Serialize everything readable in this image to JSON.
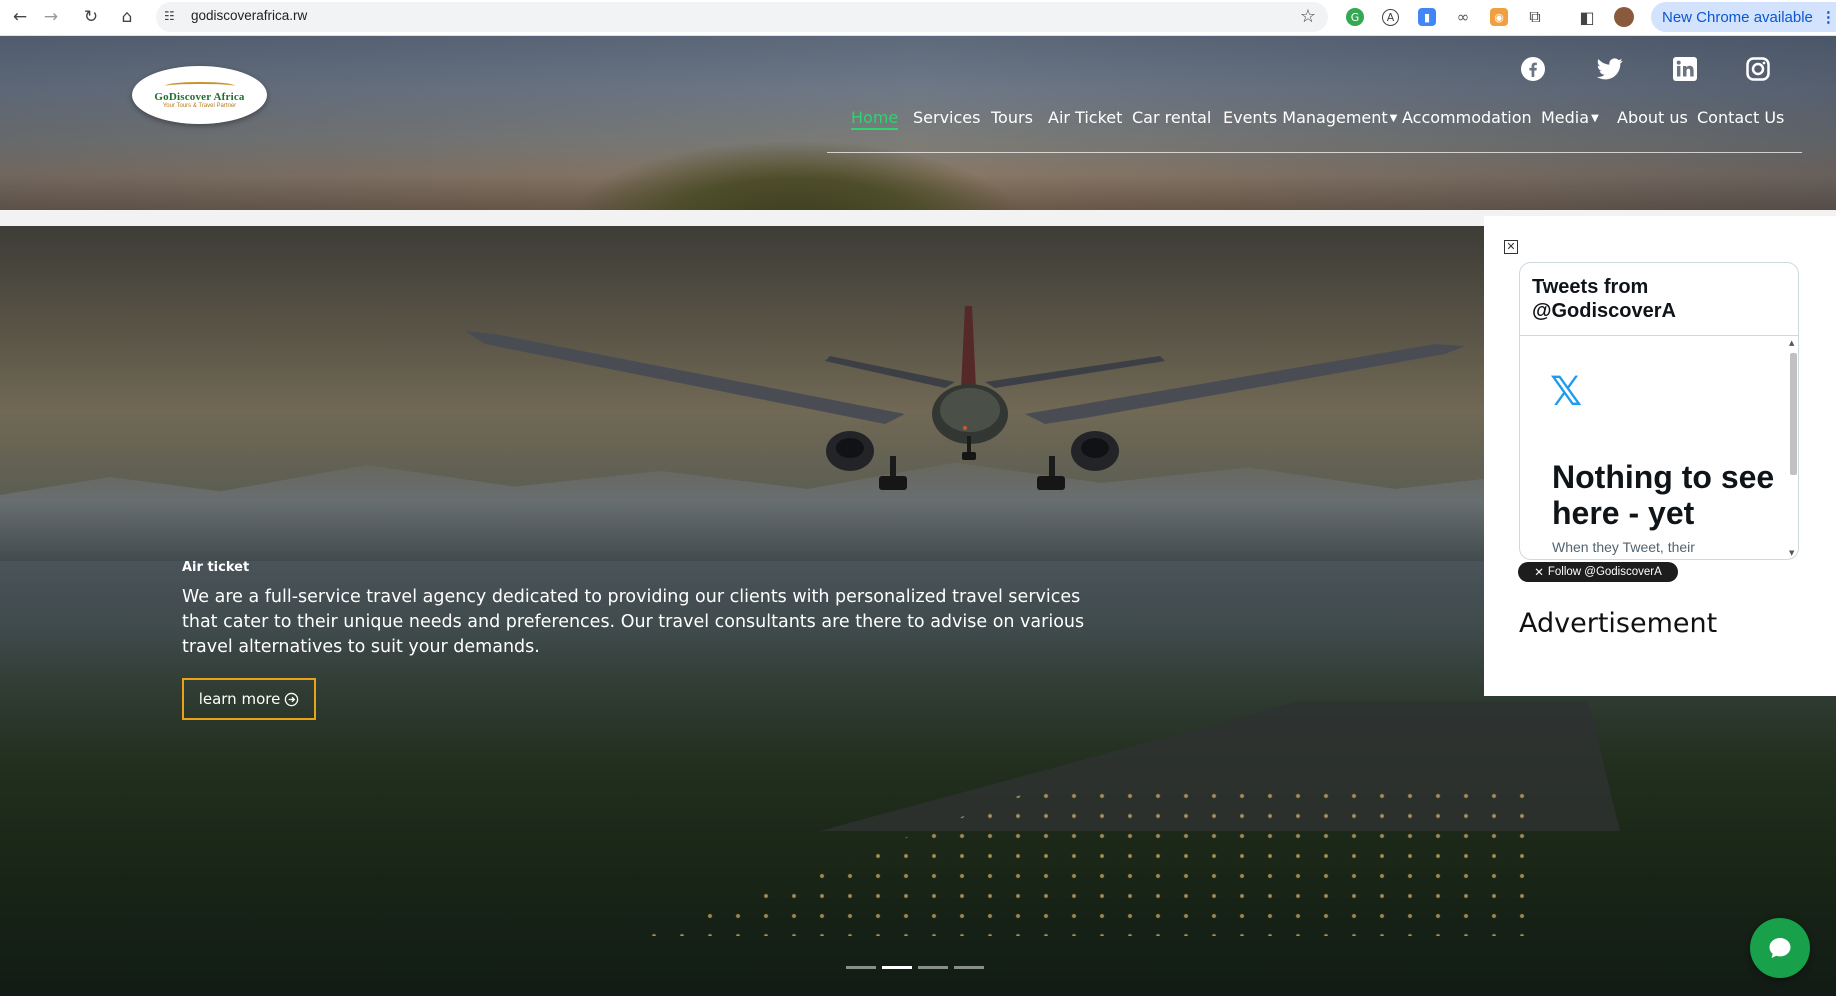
{
  "browser": {
    "url": "godiscoverafrica.rw",
    "update_label": "New Chrome available",
    "menu_glyph": "⋮",
    "back_glyph": "←",
    "forward_glyph": "→",
    "reload_glyph": "↻",
    "home_glyph": "⌂",
    "star_glyph": "☆"
  },
  "header": {
    "logo_name": "GoDiscover Africa",
    "logo_tagline": "Your Tours & Travel Partner",
    "social_icons": [
      "facebook-icon",
      "twitter-icon",
      "linkedin-icon",
      "instagram-icon"
    ],
    "nav": [
      {
        "label": "Home",
        "active": true
      },
      {
        "label": "Services"
      },
      {
        "label": "Tours"
      },
      {
        "label": "Air Ticket"
      },
      {
        "label": "Car rental"
      },
      {
        "label": "Events Management",
        "dropdown": true
      },
      {
        "label": "Accommodation"
      },
      {
        "label": "Media",
        "dropdown": true
      },
      {
        "label": "About us"
      },
      {
        "label": "Contact Us"
      }
    ],
    "active_color": "#2fd36f"
  },
  "hero": {
    "kicker": "Air ticket",
    "text": "We are a full-service travel agency dedicated to providing our clients with personalized travel services that cater to their unique needs and preferences. Our travel consultants are there to advise on various travel alternatives to suit your demands.",
    "button_label": "learn more",
    "button_icon": "arrow-circle-icon",
    "button_border_color": "#e8a317",
    "slides_total": 4,
    "active_slide": 2
  },
  "sidebar": {
    "close_glyph": "✕",
    "tweets_title": "Tweets from @GodiscoverA",
    "x_logo": "𝕏",
    "empty_title": "Nothing to see here - yet",
    "empty_sub": "When they Tweet, their",
    "follow_label": "Follow @GodiscoverA",
    "advertisement": "Advertisement"
  },
  "chat": {
    "icon": "chat-bubble-icon",
    "color": "#18a04b"
  }
}
